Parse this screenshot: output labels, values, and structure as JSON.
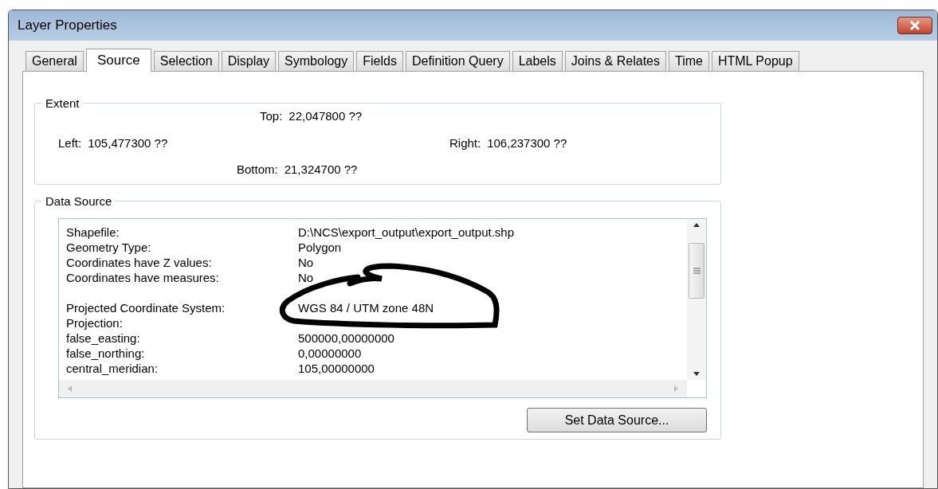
{
  "window": {
    "title": "Layer Properties"
  },
  "tabs": [
    {
      "label": "General",
      "selected": false
    },
    {
      "label": "Source",
      "selected": true
    },
    {
      "label": "Selection",
      "selected": false
    },
    {
      "label": "Display",
      "selected": false
    },
    {
      "label": "Symbology",
      "selected": false
    },
    {
      "label": "Fields",
      "selected": false
    },
    {
      "label": "Definition Query",
      "selected": false
    },
    {
      "label": "Labels",
      "selected": false
    },
    {
      "label": "Joins & Relates",
      "selected": false
    },
    {
      "label": "Time",
      "selected": false
    },
    {
      "label": "HTML Popup",
      "selected": false
    }
  ],
  "extent": {
    "title": "Extent",
    "top": {
      "label": "Top:",
      "value": "22,047800 ??"
    },
    "left": {
      "label": "Left:",
      "value": "105,477300 ??"
    },
    "right": {
      "label": "Right:",
      "value": "106,237300 ??"
    },
    "bottom": {
      "label": "Bottom:",
      "value": "21,324700 ??"
    }
  },
  "data_source": {
    "title": "Data Source",
    "sections": [
      {
        "rows": [
          {
            "label": "Shapefile:",
            "value": "D:\\NCS\\export_output\\export_output.shp"
          },
          {
            "label": "Geometry Type:",
            "value": "Polygon"
          },
          {
            "label": "Coordinates have Z values:",
            "value": "No"
          },
          {
            "label": "Coordinates have measures:",
            "value": "No"
          }
        ]
      },
      {
        "rows": [
          {
            "label": "Projected Coordinate System:",
            "value": "WGS 84 / UTM zone 48N"
          },
          {
            "label": "Projection:"
          },
          {
            "label": "false_easting:",
            "value": "500000,00000000"
          },
          {
            "label": "false_northing:",
            "value": "0,00000000"
          },
          {
            "label": "central_meridian:",
            "value": "105,00000000"
          }
        ]
      }
    ],
    "button": "Set Data Source..."
  }
}
